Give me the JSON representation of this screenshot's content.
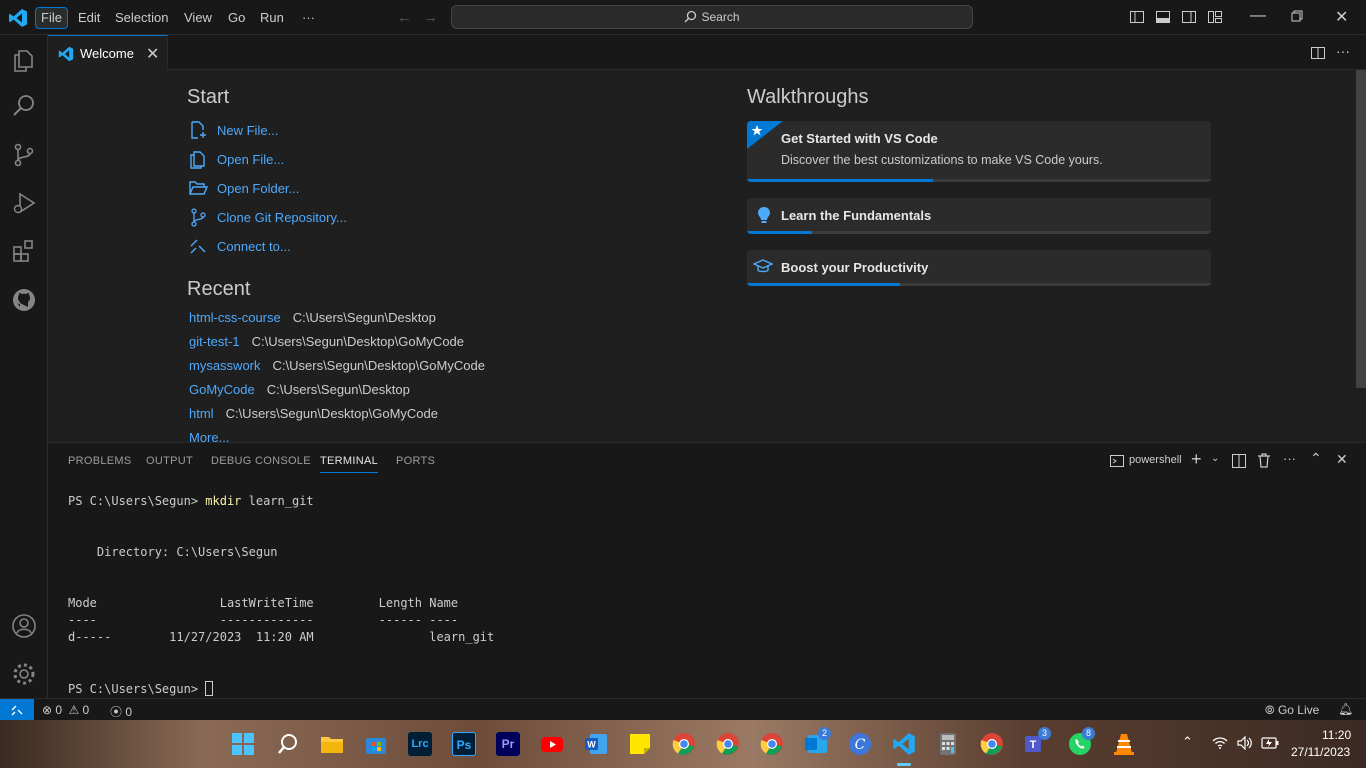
{
  "menubar": {
    "file": "File",
    "edit": "Edit",
    "selection": "Selection",
    "view": "View",
    "go": "Go",
    "run": "Run",
    "more": "···"
  },
  "search": {
    "label": "Search"
  },
  "tab": {
    "label": "Welcome",
    "close": "✕"
  },
  "welcome": {
    "start_heading": "Start",
    "start_items": [
      {
        "label": "New File...",
        "icon": "new-file-icon"
      },
      {
        "label": "Open File...",
        "icon": "open-file-icon"
      },
      {
        "label": "Open Folder...",
        "icon": "open-folder-icon"
      },
      {
        "label": "Clone Git Repository...",
        "icon": "git-clone-icon"
      },
      {
        "label": "Connect to...",
        "icon": "remote-connect-icon"
      }
    ],
    "recent_heading": "Recent",
    "recent": [
      {
        "name": "html-css-course",
        "path": "C:\\Users\\Segun\\Desktop"
      },
      {
        "name": "git-test-1",
        "path": "C:\\Users\\Segun\\Desktop\\GoMyCode"
      },
      {
        "name": "mysasswork",
        "path": "C:\\Users\\Segun\\Desktop\\GoMyCode"
      },
      {
        "name": "GoMyCode",
        "path": "C:\\Users\\Segun\\Desktop"
      },
      {
        "name": "html",
        "path": "C:\\Users\\Segun\\Desktop\\GoMyCode"
      }
    ],
    "more": "More...",
    "walkthroughs_heading": "Walkthroughs",
    "walkthroughs": [
      {
        "title": "Get Started with VS Code",
        "description": "Discover the best customizations to make VS Code yours.",
        "progress": 0.4
      },
      {
        "title": "Learn the Fundamentals",
        "progress": 0.14
      },
      {
        "title": "Boost your Productivity",
        "progress": 0.33
      }
    ]
  },
  "panel": {
    "tabs": [
      "PROBLEMS",
      "OUTPUT",
      "DEBUG CONSOLE",
      "TERMINAL",
      "PORTS"
    ],
    "active_tab": "TERMINAL",
    "shell": "powershell",
    "terminal": {
      "prompt1": "PS C:\\Users\\Segun> ",
      "cmd1": "mkdir",
      "arg1": " learn_git",
      "dir_line": "    Directory: C:\\Users\\Segun",
      "header": "Mode                 LastWriteTime         Length Name",
      "sep": "----                 -------------         ------ ----",
      "row": "d-----        11/27/2023  11:20 AM                learn_git",
      "prompt2": "PS C:\\Users\\Segun> "
    }
  },
  "statusbar": {
    "errors": "0",
    "warnings": "0",
    "ports": "0",
    "golive": "Go Live"
  },
  "taskbar": {
    "time": "11:20",
    "date": "27/11/2023",
    "badges": {
      "chrome1": "",
      "vscode2": "2",
      "teams": "3",
      "whatsapp": "8"
    },
    "lrc": "Lrc",
    "ps": "Ps",
    "pr": "Pr"
  },
  "colors": {
    "accent": "#0078d4",
    "link": "#4daafc",
    "background": "#1f1f1f",
    "sidebar": "#181818"
  }
}
